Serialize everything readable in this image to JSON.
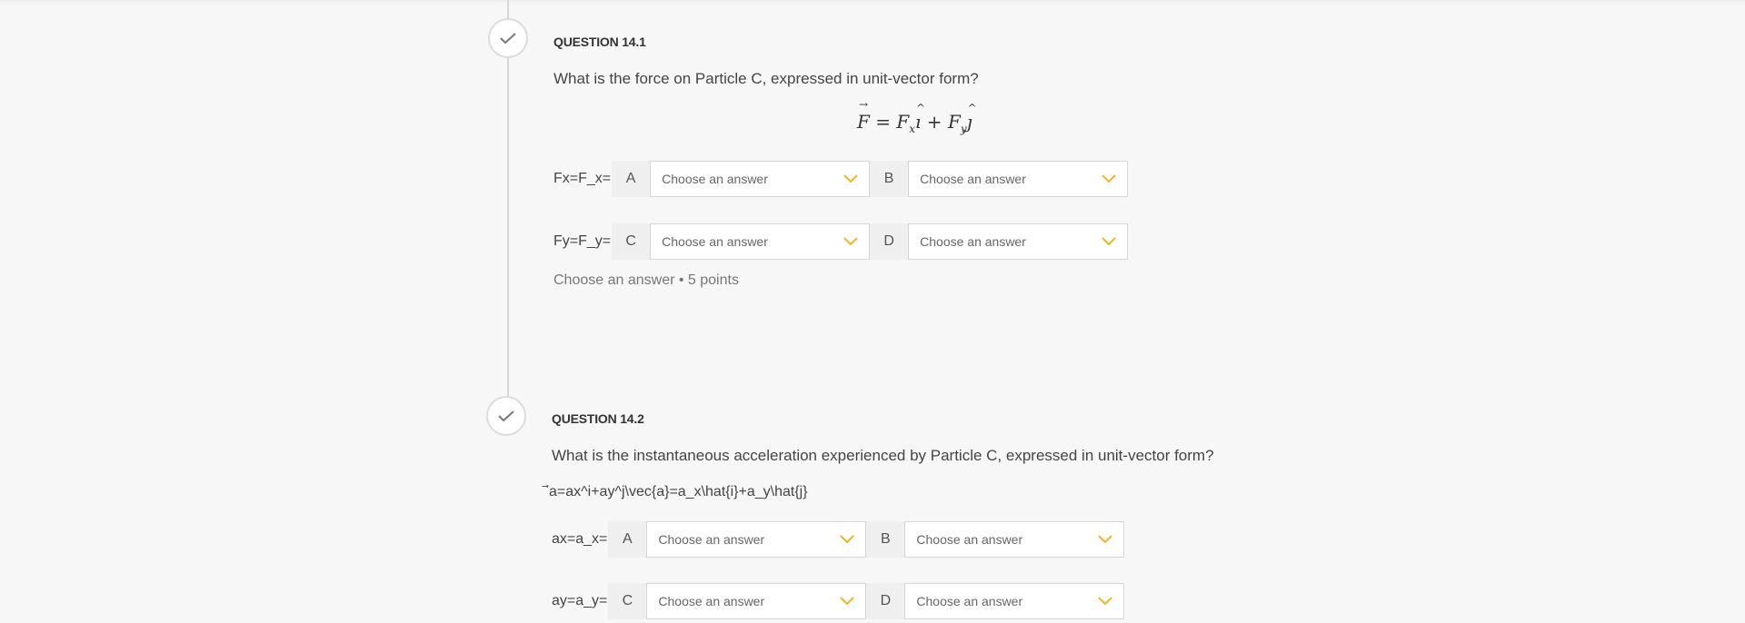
{
  "colors": {
    "accent": "#f5b324",
    "timeline": "#d6d6d6",
    "background": "#f7f7f7"
  },
  "questions": [
    {
      "number": "QUESTION 14.1",
      "text": "What is the force on Particle C, expressed in unit-vector form?",
      "formula_rendered": "F⃗ = Fₓî + Fᵧĵ",
      "rows": [
        {
          "label": "Fx=F_x=",
          "blanks": [
            {
              "letter": "A",
              "value": "Choose an answer"
            },
            {
              "letter": "B",
              "value": "Choose an answer"
            }
          ]
        },
        {
          "label": "Fy=F_y=",
          "blanks": [
            {
              "letter": "C",
              "value": "Choose an answer"
            },
            {
              "letter": "D",
              "value": "Choose an answer"
            }
          ]
        }
      ],
      "status": "Choose an answer • 5 points"
    },
    {
      "number": "QUESTION 14.2",
      "text": "What is the instantaneous acceleration experienced by Particle C, expressed in unit-vector form?",
      "formula_raw": "⃗a=ax^i+ay^j\\vec{a}=a_x\\hat{i}+a_y\\hat{j}",
      "rows": [
        {
          "label": "ax=a_x=",
          "blanks": [
            {
              "letter": "A",
              "value": "Choose an answer"
            },
            {
              "letter": "B",
              "value": "Choose an answer"
            }
          ]
        },
        {
          "label": "ay=a_y=",
          "blanks": [
            {
              "letter": "C",
              "value": "Choose an answer"
            },
            {
              "letter": "D",
              "value": "Choose an answer"
            }
          ]
        }
      ]
    }
  ]
}
